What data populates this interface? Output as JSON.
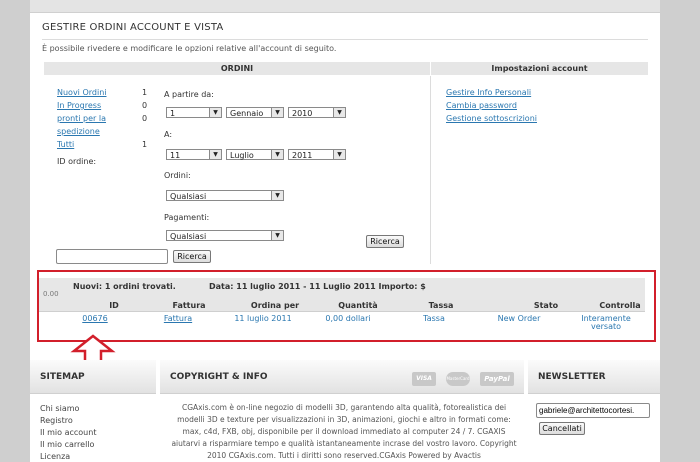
{
  "header": {
    "title": "GESTIRE ORDINI ACCOUNT E VISTA",
    "subtitle": "È possibile rivedere e modificare le opzioni relative all'account di seguito."
  },
  "orders": {
    "heading": "ORDINI",
    "links": [
      {
        "label": "Nuovi Ordini",
        "count": "1"
      },
      {
        "label": "In Progress",
        "count": "0"
      },
      {
        "label": "pronti per la",
        "count": "0"
      },
      {
        "label": "spedizione",
        "count": ""
      },
      {
        "label": "Tutti",
        "count": "1"
      }
    ],
    "id_label": "ID ordine:",
    "search_value": "",
    "search_button": "Ricerca",
    "from_label": "A partire da:",
    "from": {
      "day": "1",
      "month": "Gennaio",
      "year": "2010"
    },
    "to_label": "A:",
    "to": {
      "day": "11",
      "month": "Luglio",
      "year": "2011"
    },
    "orders_label": "Ordini:",
    "orders_select": "Qualsiasi",
    "payments_label": "Pagamenti:",
    "payments_select": "Qualsiasi",
    "filter_button": "Ricerca",
    "arrow_glyph": "▼"
  },
  "settings": {
    "heading": "Impostazioni account",
    "links": [
      "Gestire Info Personali",
      "Cambia password",
      "Gestione sottoscrizioni"
    ]
  },
  "results": {
    "summary_left": "Nuovi: 1 ordini trovati.",
    "summary_right": "Data: 11 luglio 2011 - 11 Luglio 2011 Importo: $",
    "partial_text": "0.00",
    "columns": [
      "ID",
      "Fattura",
      "Ordina per",
      "Quantità",
      "Tassa",
      "Stato",
      "Controlla"
    ],
    "row": {
      "id": "00676",
      "invoice": "Fattura",
      "date": "11 luglio 2011",
      "amount": "0,00 dollari",
      "tax": "Tassa",
      "status": "New Order",
      "check_line1": "Interamente",
      "check_line2": "versato"
    }
  },
  "footer": {
    "sitemap": {
      "heading": "SITEMAP",
      "links": [
        "Chi siamo",
        "Registro",
        "Il mio account",
        "Il mio carrello",
        "Licenza"
      ]
    },
    "copyright": {
      "heading": "COPYRIGHT & INFO",
      "cards": [
        "VISA",
        "MasterCard",
        "PayPal"
      ],
      "text": "CGAxis.com è on-line negozio di modelli 3D, garantendo alta qualità, fotorealistica dei modelli 3D e texture per visualizzazioni in 3D, animazioni, giochi e altro in formati come: max, c4d, FXB, obj, disponibile per il download immediato al computer 24 / 7. CGAXIS aiutarvi a risparmiare tempo e qualità istantaneamente incrase del vostro lavoro.",
      "bottom": "Copyright 2010 CGAxis.com. Tutti i diritti sono reserved.CGAxis Powered by Avactis"
    },
    "newsletter": {
      "heading": "NEWSLETTER",
      "email": "gabriele@architettocortesi.",
      "button": "Cancellati"
    }
  },
  "colors": {
    "accent_link": "#2a77b0",
    "highlight": "#d21f2b"
  }
}
